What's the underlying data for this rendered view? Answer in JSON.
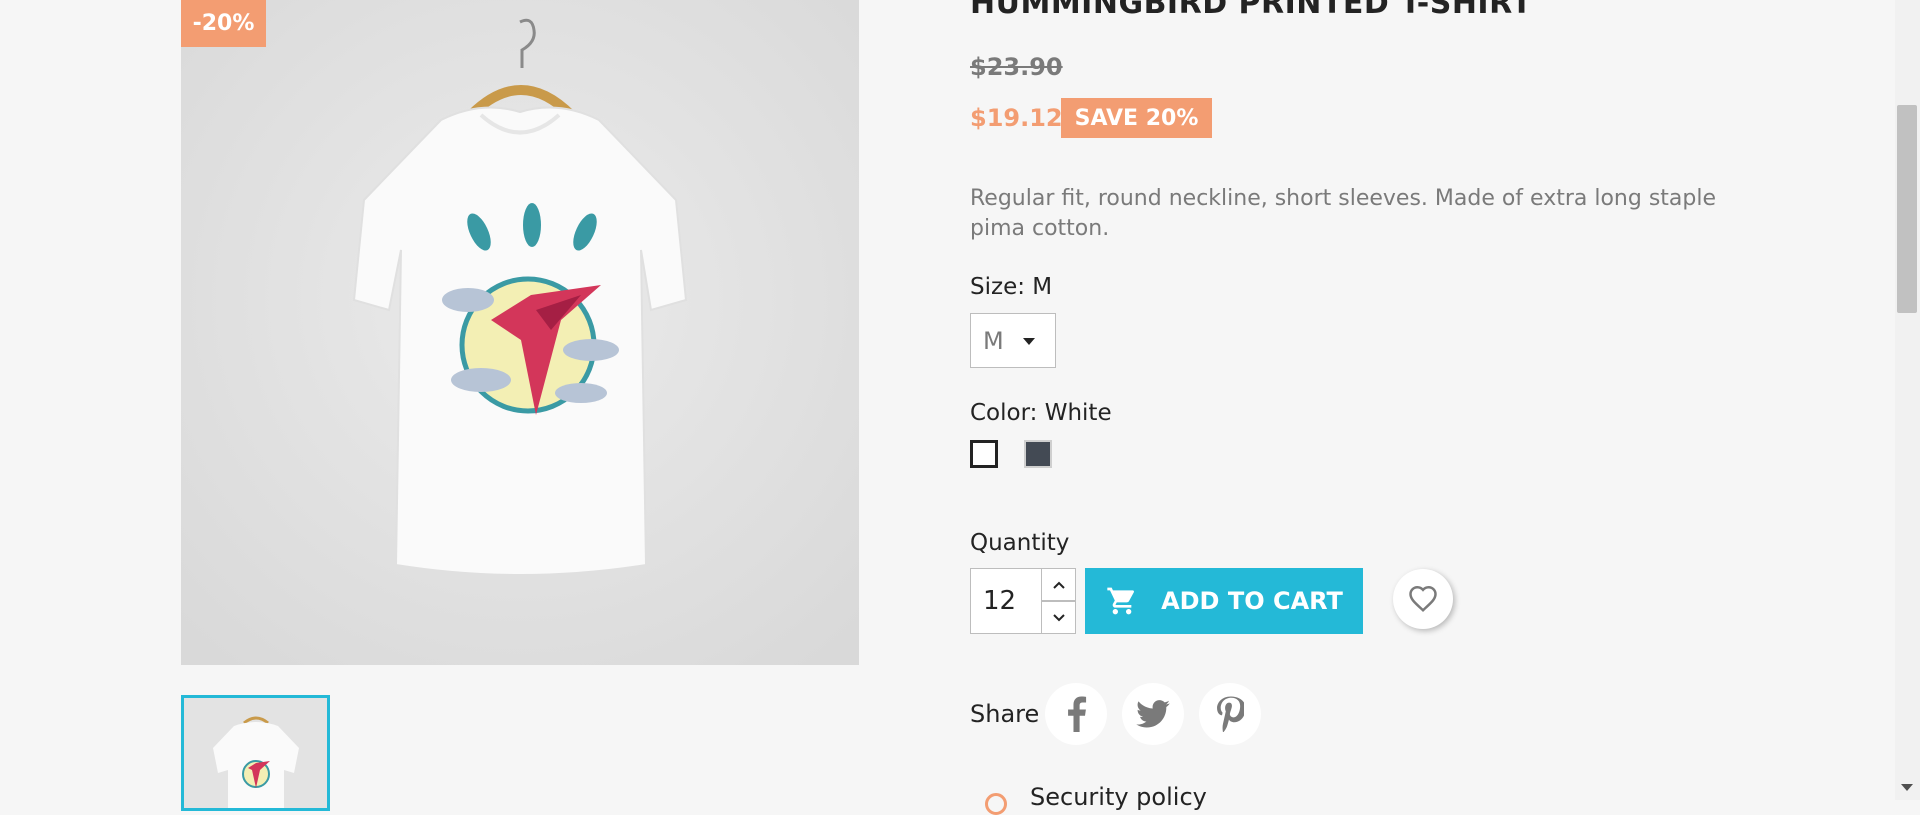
{
  "product": {
    "title": "HUMMINGBIRD PRINTED T-SHIRT",
    "discount_flag": "-20%",
    "regular_price": "$23.90",
    "current_price": "$19.12",
    "save_badge": "SAVE 20%",
    "description": "Regular fit, round neckline, short sleeves. Made of extra long staple pima cotton."
  },
  "size": {
    "label_prefix": "Size: ",
    "selected_label": "M",
    "select_value": "M"
  },
  "color": {
    "label_prefix": "Color: ",
    "selected_label": "White",
    "swatches": [
      {
        "name": "White",
        "hex": "#ffffff"
      },
      {
        "name": "Grey",
        "hex": "#434a54"
      }
    ]
  },
  "quantity": {
    "label": "Quantity",
    "value": "12"
  },
  "cart": {
    "button_label": "ADD TO CART"
  },
  "share": {
    "label": "Share"
  },
  "reassurance": {
    "security_label": "Security policy"
  },
  "colors": {
    "accent": "#24b9d7",
    "sale": "#f39d72",
    "background": "#f6f6f6"
  },
  "icons": [
    "cart-icon",
    "heart-icon",
    "facebook-icon",
    "twitter-icon",
    "pinterest-icon",
    "chevron-up-icon",
    "chevron-down-icon"
  ]
}
